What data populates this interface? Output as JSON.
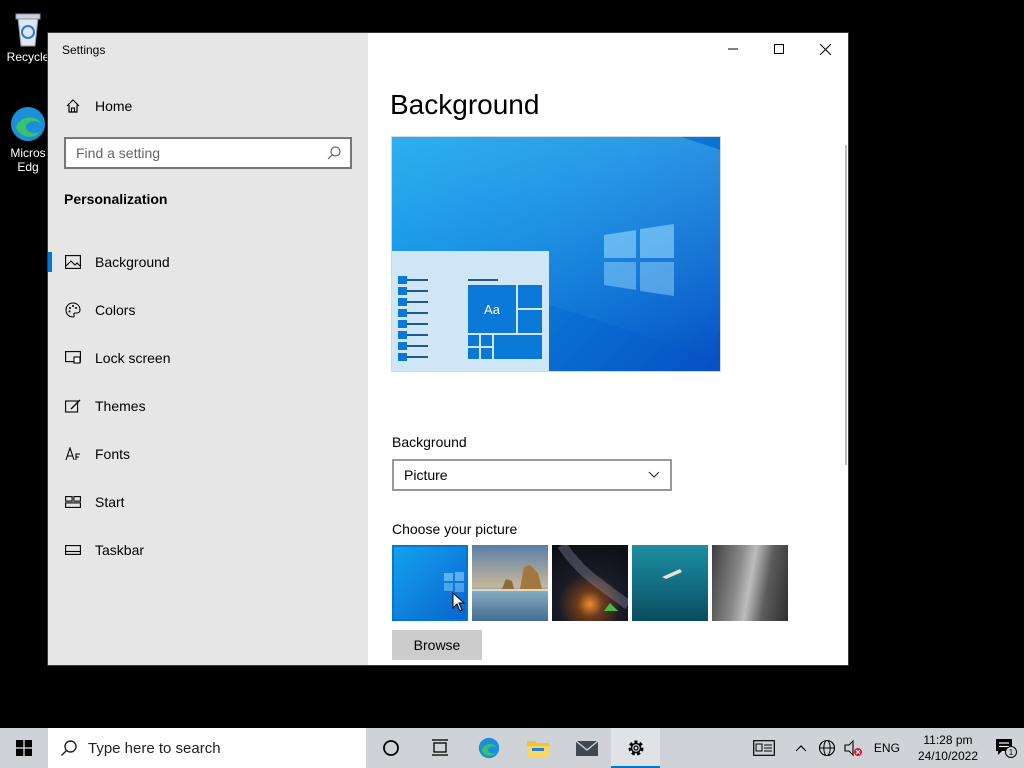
{
  "desktop": {
    "icons": [
      {
        "label": "Recycle",
        "icon": "recycle-bin-icon"
      },
      {
        "label": "Micros\nEdg",
        "icon": "edge-icon"
      }
    ]
  },
  "window": {
    "title": "Settings",
    "controls": {
      "minimize": "minimize-icon",
      "maximize": "maximize-icon",
      "close": "close-icon"
    }
  },
  "sidebar": {
    "home_label": "Home",
    "search_placeholder": "Find a setting",
    "section_title": "Personalization",
    "items": [
      {
        "label": "Background",
        "icon": "picture-icon",
        "active": true
      },
      {
        "label": "Colors",
        "icon": "palette-icon"
      },
      {
        "label": "Lock screen",
        "icon": "lock-screen-icon"
      },
      {
        "label": "Themes",
        "icon": "themes-icon"
      },
      {
        "label": "Fonts",
        "icon": "fonts-icon"
      },
      {
        "label": "Start",
        "icon": "start-icon"
      },
      {
        "label": "Taskbar",
        "icon": "taskbar-icon"
      }
    ]
  },
  "main": {
    "title": "Background",
    "preview_tile_text": "Aa",
    "background_label": "Background",
    "background_value": "Picture",
    "choose_label": "Choose your picture",
    "browse_label": "Browse"
  },
  "taskbar": {
    "search_placeholder": "Type here to search",
    "language": "ENG",
    "time": "11:28 pm",
    "date": "24/10/2022",
    "notification_count": "1"
  },
  "colors": {
    "accent": "#0078d4",
    "sidebar_bg": "#e6e6e6",
    "taskbar_bg": "#cfd3d8"
  }
}
